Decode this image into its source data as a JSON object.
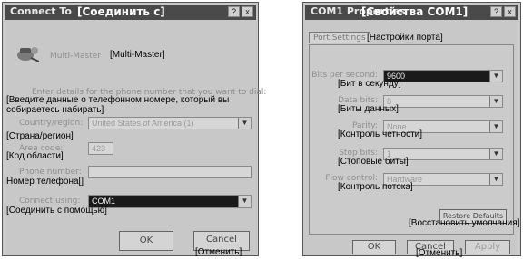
{
  "connect_dialog": {
    "title": "Connect To",
    "title_translation": "[Соединить с]",
    "help_button": "?",
    "close_button": "x",
    "connection_name": "Multi-Master",
    "connection_name_translation": "[Multi-Master]",
    "intro": "Enter details for the phone number that you want to dial:",
    "intro_translation": "[Введите данные о телефонном номере, который вы собираетесь набирать]",
    "country_label": "Country/region:",
    "country_label_translation": "[Страна/регион]",
    "country_value": "United States of America (1)",
    "area_code_label": "Area code:",
    "area_code_label_translation": "[Код области]",
    "area_code_value": "423",
    "phone_label": "Phone number:",
    "phone_label_translation": "Номер телефона[]",
    "phone_value": "",
    "connect_using_label": "Connect using:",
    "connect_using_label_translation": "[Соединить с помощью]",
    "connect_using_value": "COM1",
    "ok_label": "OK",
    "cancel_label": "Cancel",
    "cancel_translation": "[Отменить]"
  },
  "com_dialog": {
    "title": "COM1 Properties",
    "title_translation": "[Свойства COM1]",
    "help_button": "?",
    "close_button": "x",
    "tab_label": "Port Settings",
    "tab_translation": "[Настройки порта]",
    "fields": [
      {
        "label": "Bits per second:",
        "value": "9600",
        "translation": "[Бит в секунду]",
        "dark": true
      },
      {
        "label": "Data bits:",
        "value": "8",
        "translation": "[Биты данных]",
        "dark": false
      },
      {
        "label": "Parity:",
        "value": "None",
        "translation": "[Контроль четности]",
        "dark": false
      },
      {
        "label": "Stop bits:",
        "value": "1",
        "translation": "[Стоповые биты]",
        "dark": false
      },
      {
        "label": "Flow control:",
        "value": "Hardware",
        "translation": "[Контроль потока]",
        "dark": false
      }
    ],
    "restore_label": "Restore Defaults",
    "restore_translation": "[Восстановить умолчания]",
    "ok_label": "OK",
    "cancel_label": "Cancel",
    "cancel_translation": "[Отменить]",
    "apply_label": "Apply"
  }
}
